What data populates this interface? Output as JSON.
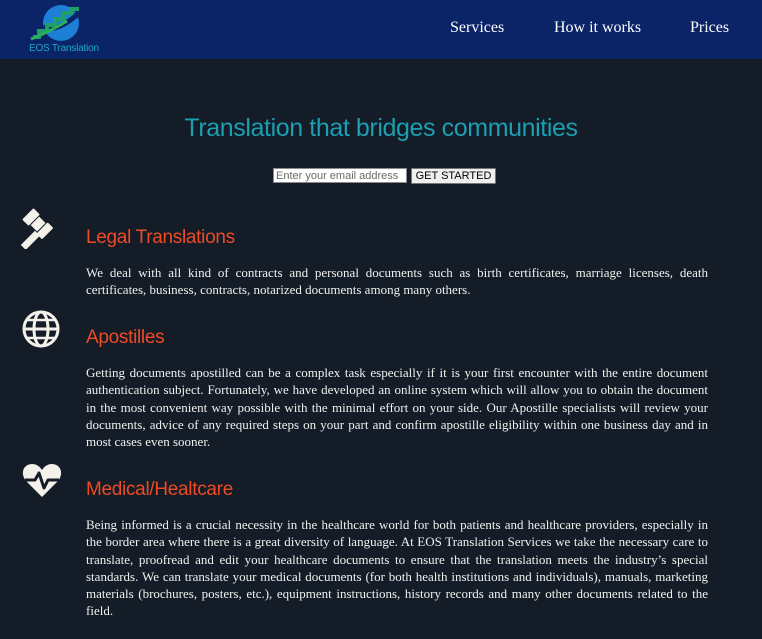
{
  "header": {
    "logo_text": "EOS Translation",
    "nav": [
      {
        "label": "Services"
      },
      {
        "label": "How it works"
      },
      {
        "label": "Prices"
      }
    ]
  },
  "hero": {
    "title": "Translation that bridges communities",
    "email_placeholder": "Enter your email address",
    "cta_label": "GET STARTED"
  },
  "sections": [
    {
      "icon": "gavel-icon",
      "title": "Legal Translations",
      "body": "We deal with all kind of contracts and personal documents such as birth certificates, marriage licenses, death certificates, business, contracts, notarized documents among many others."
    },
    {
      "icon": "globe-icon",
      "title": "Apostilles",
      "body": "Getting documents apostilled can be a complex task especially if it is your first encounter with the entire document authentication subject. Fortunately, we have developed an online system which will allow you to obtain the document in the most convenient way possible with the minimal effort on your side. Our Apostille specialists will review your documents, advice of any required steps on your part and confirm apostille eligibility within one business day and in most cases even sooner."
    },
    {
      "icon": "heartbeat-icon",
      "title": "Medical/Healtcare",
      "body": "Being informed is a crucial necessity in the healthcare world for both patients and healthcare providers, especially in the border area where there is a great diversity of language. At EOS Translation Services we take the necessary care to translate, proofread and edit your healthcare documents to ensure that the translation meets the industry’s special standards. We can translate your medical documents (for both health institutions and individuals), manuals, marketing materials (brochures, posters, etc.), equipment instructions, history records and many other documents related to the field."
    }
  ],
  "colors": {
    "background": "#131c27",
    "header": "#0b2468",
    "accent_teal": "#1a9fb3",
    "accent_orange": "#ee4b25"
  }
}
